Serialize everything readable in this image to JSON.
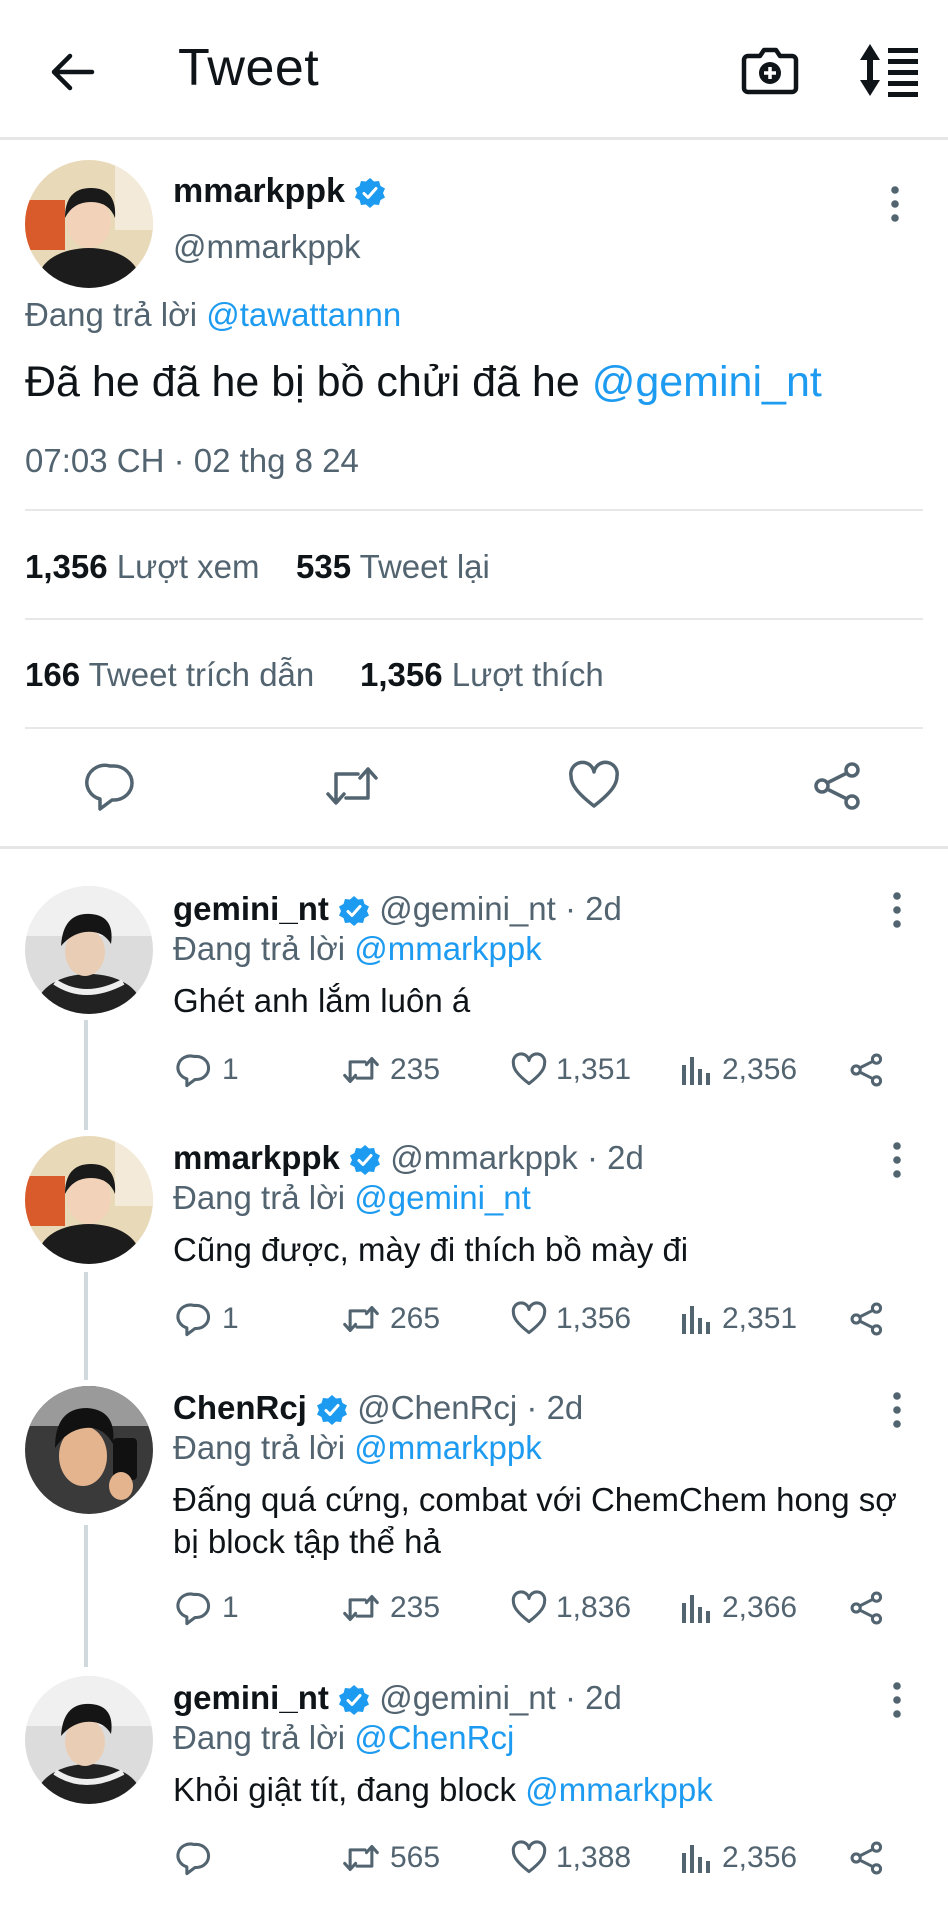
{
  "header": {
    "title": "Tweet",
    "icons": [
      "back-arrow-icon",
      "camera-add-icon",
      "sort-icon"
    ]
  },
  "main_tweet": {
    "name": "mmarkppk",
    "handle": "@mmarkppk",
    "replying_prefix": "Đang trả lời",
    "replying_to": "@tawattannn",
    "text": "Đã he đã he bị bồ chửi đã he",
    "text_mention": "@gemini_nt",
    "timestamp": "07:03 CH · 02 thg 8 24",
    "views_count": "1,356",
    "views_label": "Lượt xem",
    "retweets_count": "535",
    "retweets_label": "Tweet lại",
    "quotes_count": "166",
    "quotes_label": "Tweet trích dẫn",
    "likes_count": "1,356",
    "likes_label": "Lượt thích"
  },
  "replies": [
    {
      "name": "gemini_nt",
      "handle": "@gemini_nt · 2d",
      "replying_prefix": "Đang trả lời",
      "replying_to": "@mmarkppk",
      "text": "Ghét anh lắm luôn á",
      "replies": "1",
      "retweets": "235",
      "likes": "1,351",
      "views": "2,356"
    },
    {
      "name": "mmarkppk",
      "handle": "@mmarkppk · 2d",
      "replying_prefix": "Đang trả lời",
      "replying_to": "@gemini_nt",
      "text": "Cũng được, mày đi thích bồ mày đi",
      "replies": "1",
      "retweets": "265",
      "likes": "1,356",
      "views": "2,351"
    },
    {
      "name": "ChenRcj",
      "handle": "@ChenRcj · 2d",
      "replying_prefix": "Đang trả lời",
      "replying_to": "@mmarkppk",
      "text_line1": "Đấng quá cứng, combat với ChemChem hong sợ",
      "text_line2": "bị block tập thể hả",
      "replies": "1",
      "retweets": "235",
      "likes": "1,836",
      "views": "2,366"
    },
    {
      "name": "gemini_nt",
      "handle": "@gemini_nt · 2d",
      "replying_prefix": "Đang trả lời",
      "replying_to": "@ChenRcj",
      "text": "Khỏi giật tít, đang block",
      "text_mention": "@mmarkppk",
      "replies": "",
      "retweets": "565",
      "likes": "1,388",
      "views": "2,356"
    }
  ],
  "colors": {
    "accent": "#1d9bf0",
    "muted": "#536471",
    "text": "#0f1419",
    "divider": "#e7e7e7"
  }
}
